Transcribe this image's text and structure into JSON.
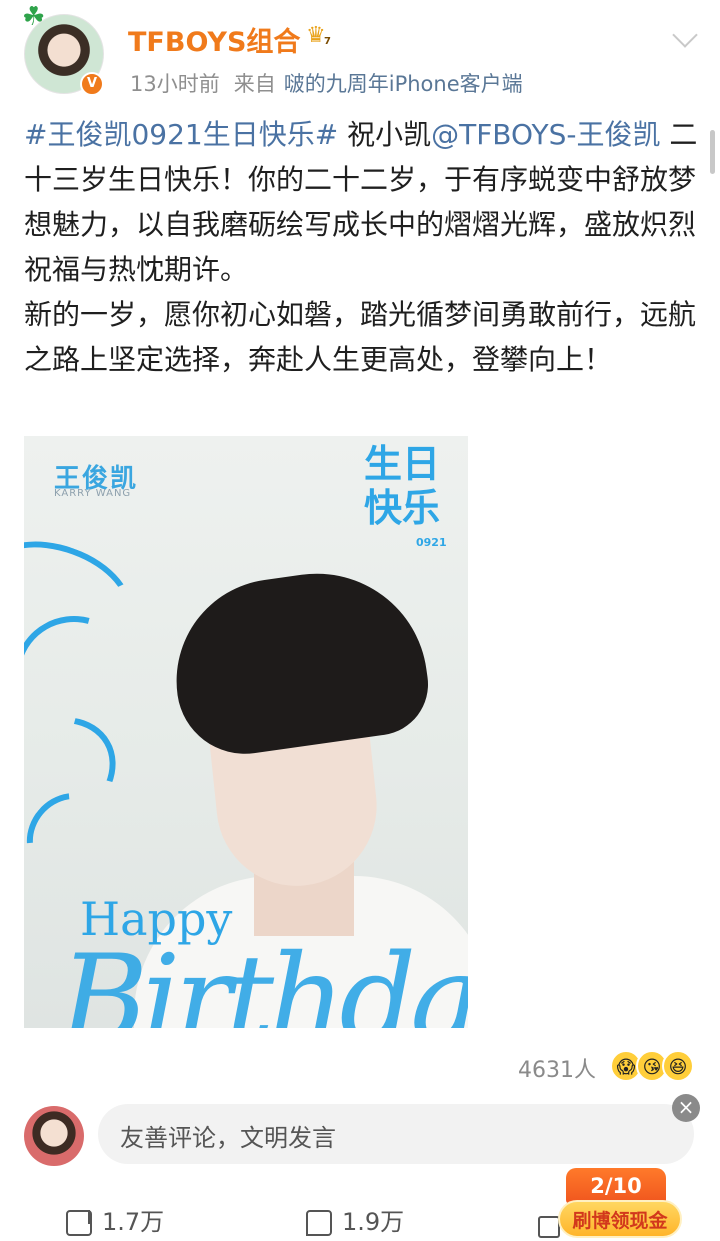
{
  "header": {
    "username": "TFBOYS组合",
    "crown_level": "7",
    "time": "13小时前",
    "source_prefix": "来自",
    "source": "啵的九周年iPhone客户端"
  },
  "post": {
    "hashtag": "#王俊凯0921生日快乐#",
    "text_before_mention": " 祝小凯",
    "mention": "@TFBOYS-王俊凯",
    "paragraph1_rest": " 二十三岁生日快乐！你的二十二岁，于有序蜕变中舒放梦想魅力，以自我磨砺绘写成长中的熠熠光辉，盛放炽烈祝福与热忱期许。",
    "paragraph2": "新的一岁，愿你初心如磐，踏光循梦间勇敢前行，远航之路上坚定选择，奔赴人生更高处，登攀向上！"
  },
  "image": {
    "name_cn": "王俊凯",
    "name_en": "KARRY WANG",
    "bday_cn": "生日快乐",
    "bday_num": "0921",
    "happy": "Happy",
    "birthday": "Birthday"
  },
  "reactions": {
    "count": "4631人",
    "emojis": [
      "😱",
      "😘",
      "😆"
    ]
  },
  "comment": {
    "placeholder": "友善评论，文明发言"
  },
  "actions": {
    "share_count": "1.7万",
    "comment_count": "1.9万"
  },
  "promo": {
    "progress": "2/10",
    "label": "刷博领现金"
  }
}
